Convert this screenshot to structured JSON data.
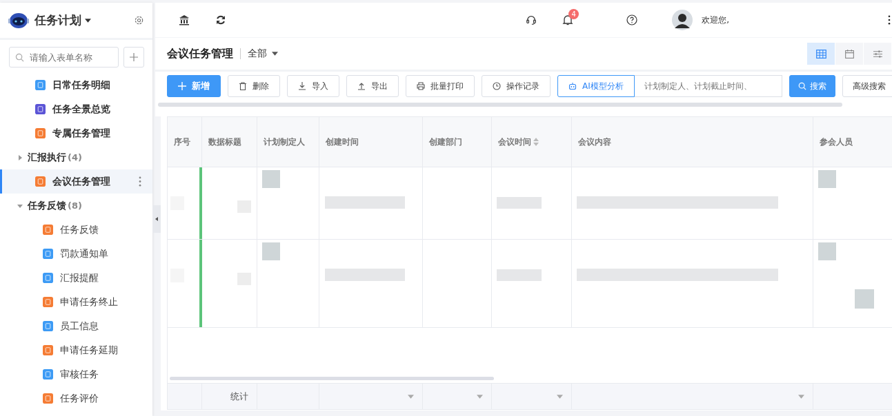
{
  "sidebar": {
    "app_title": "任务计划",
    "search": {
      "placeholder": "请输入表单名称"
    },
    "items": [
      {
        "kind": "form",
        "label": "日常任务明细",
        "color": "#3d9bf5",
        "selected": false
      },
      {
        "kind": "form",
        "label": "任务全景总览",
        "color": "#5b54d6",
        "selected": false
      },
      {
        "kind": "form",
        "label": "专属任务管理",
        "color": "#f57c34",
        "selected": false
      },
      {
        "kind": "group",
        "label": "汇报执行",
        "count": "(4)",
        "expanded": false
      },
      {
        "kind": "form",
        "label": "会议任务管理",
        "color": "#f57c34",
        "selected": true
      },
      {
        "kind": "group",
        "label": "任务反馈",
        "count": "(8)",
        "expanded": true,
        "children": [
          {
            "kind": "form",
            "label": "任务反馈",
            "color": "#f57c34",
            "selected": false
          },
          {
            "kind": "form",
            "label": "罚款通知单",
            "color": "#3d9bf5",
            "selected": false
          },
          {
            "kind": "form",
            "label": "汇报提醒",
            "color": "#3d9bf5",
            "selected": false
          },
          {
            "kind": "form",
            "label": "申请任务终止",
            "color": "#f57c34",
            "selected": false
          },
          {
            "kind": "form",
            "label": "员工信息",
            "color": "#3d9bf5",
            "selected": false
          },
          {
            "kind": "form",
            "label": "申请任务延期",
            "color": "#f57c34",
            "selected": false
          },
          {
            "kind": "form",
            "label": "审核任务",
            "color": "#3d9bf5",
            "selected": false
          },
          {
            "kind": "form",
            "label": "任务评价",
            "color": "#f57c34",
            "selected": false
          }
        ]
      }
    ]
  },
  "topbar": {
    "notification_count": "4",
    "greeting": "欢迎您,"
  },
  "page": {
    "title": "会议任务管理",
    "filter": "全部",
    "views": [
      {
        "kind": "table",
        "selected": true
      },
      {
        "kind": "calendar",
        "selected": false
      },
      {
        "kind": "settings",
        "selected": false
      }
    ]
  },
  "toolbar": {
    "buttons": [
      {
        "kind": "add",
        "label": "新增"
      },
      {
        "kind": "delete",
        "label": "删除"
      },
      {
        "kind": "import",
        "label": "导入"
      },
      {
        "kind": "export",
        "label": "导出"
      },
      {
        "kind": "print",
        "label": "批量打印"
      },
      {
        "kind": "history",
        "label": "操作记录"
      },
      {
        "kind": "ai",
        "label": "AI模型分析"
      }
    ],
    "search": {
      "placeholder": "计划制定人、计划截止时间、"
    },
    "search_button": "搜索",
    "advanced_button": "高级搜索"
  },
  "table": {
    "columns": [
      {
        "label": "序号",
        "sortable": false
      },
      {
        "label": "数据标题",
        "sortable": false
      },
      {
        "label": "计划制定人",
        "sortable": false
      },
      {
        "label": "创建时间",
        "sortable": false
      },
      {
        "label": "创建部门",
        "sortable": false
      },
      {
        "label": "会议时间",
        "sortable": true
      },
      {
        "label": "会议内容",
        "sortable": false
      },
      {
        "label": "参会人员",
        "sortable": false
      }
    ],
    "rows": [
      {
        "color": "#5cc47a"
      },
      {
        "color": "#5cc47a"
      }
    ],
    "footer": [
      {
        "kind": "empty"
      },
      {
        "kind": "label",
        "label": "统计"
      },
      {
        "kind": "empty"
      },
      {
        "kind": "dropdown"
      },
      {
        "kind": "dropdown"
      },
      {
        "kind": "dropdown"
      },
      {
        "kind": "dropdown"
      },
      {
        "kind": "empty"
      }
    ]
  }
}
